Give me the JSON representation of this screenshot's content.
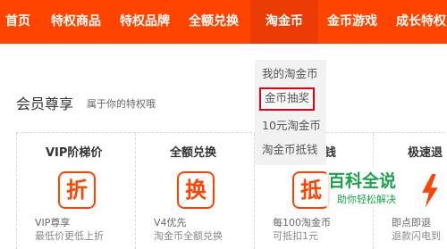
{
  "nav": {
    "items": [
      {
        "label": "首页"
      },
      {
        "label": "特权商品"
      },
      {
        "label": "特权品牌"
      },
      {
        "label": "全额兑换"
      },
      {
        "label": "淘金币"
      },
      {
        "label": "金币游戏"
      },
      {
        "label": "成长特权"
      }
    ],
    "active_index": 4
  },
  "dropdown": {
    "items": [
      {
        "label": "我的淘金币"
      },
      {
        "label": "金币抽奖"
      },
      {
        "label": "10元淘金币"
      },
      {
        "label": "淘金币抵钱"
      }
    ],
    "selected_index": 1
  },
  "member": {
    "title": "会员尊享",
    "subtitle": "属于你的特权哦"
  },
  "cards": [
    {
      "title": "VIP阶梯价",
      "icon_char": "折",
      "desc": "VIP尊享",
      "desc2": "最低价更低上折"
    },
    {
      "title": "全额兑换",
      "icon_char": "换",
      "desc": "V4优先",
      "desc2": "淘金币全额兑换"
    },
    {
      "title": "钱",
      "icon_char": "抵",
      "desc": "每100淘金币",
      "desc2": "可抵扣1元"
    },
    {
      "title": "极速退",
      "desc": "即点即退",
      "desc2": "退款闪电到"
    }
  ],
  "watermark": {
    "main": "百科全说",
    "sub": "助你轻松解决"
  },
  "colors": {
    "brand": "#ff4400",
    "active_tab": "#eb3c05",
    "highlight_border": "#e60012",
    "watermark": "#1aa34a"
  }
}
